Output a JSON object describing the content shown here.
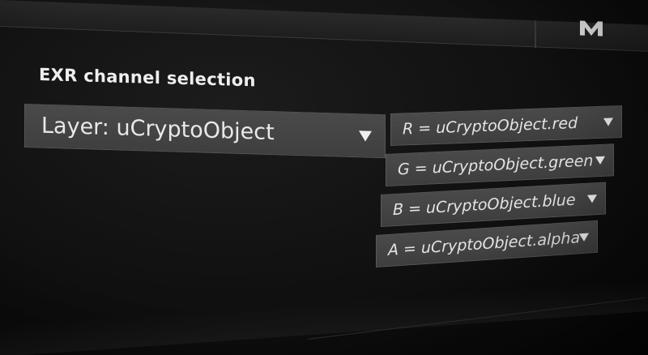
{
  "section": {
    "title": "EXR channel selection"
  },
  "layer": {
    "label": "Layer: uCryptoObject"
  },
  "channels": [
    {
      "label": "R = uCryptoObject.red"
    },
    {
      "label": "G = uCryptoObject.green"
    },
    {
      "label": "B = uCryptoObject.blue"
    },
    {
      "label": "A = uCryptoObject.alpha"
    }
  ],
  "icons": {
    "dropdown": "chevron-down-icon",
    "logo": "app-logo-icon"
  },
  "colors": {
    "background": "#121212",
    "control": "#444444",
    "text": "#e8e8e8"
  }
}
